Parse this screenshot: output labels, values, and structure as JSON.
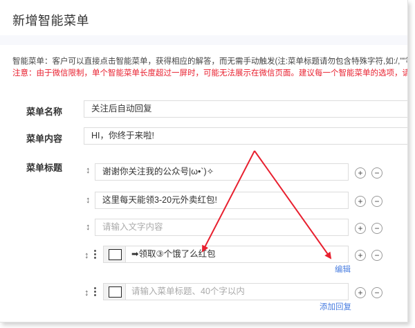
{
  "page": {
    "title": "新增智能菜单"
  },
  "info": {
    "line1": "智能菜单：客户可以直接点击智能菜单，获得相应的解答，而无需手动触发(注:菜单标题请勿包含特殊字符,如:/,\"\"等。)。",
    "line2": "注意：由于微信限制，单个智能菜单长度超过一屏时，可能无法展示在微信页面。建议每一个智能菜单的选项，请勿添加"
  },
  "form": {
    "name_label": "菜单名称",
    "name_value": "关注后自动回复",
    "content_label": "菜单内容",
    "content_value": "HI，你终于来啦!",
    "titles_label": "菜单标题",
    "rows": [
      {
        "text": "谢谢你关注我的公众号|ω•`)✧"
      },
      {
        "text": "这里每天能领3-20元外卖红包!"
      },
      {
        "placeholder": "请输入文字内容"
      },
      {
        "text": "➡领取③个饿了么红包",
        "link": "编辑"
      },
      {
        "placeholder": "请输入菜单标题、40个字以内",
        "link": "添加回复"
      }
    ]
  },
  "controls": {
    "add_symbol": "+",
    "remove_symbol": "−",
    "drag_symbol": "↕"
  },
  "colors": {
    "arrow": "#e8202f",
    "link": "#4a7ee0",
    "warning": "#e8202f"
  }
}
